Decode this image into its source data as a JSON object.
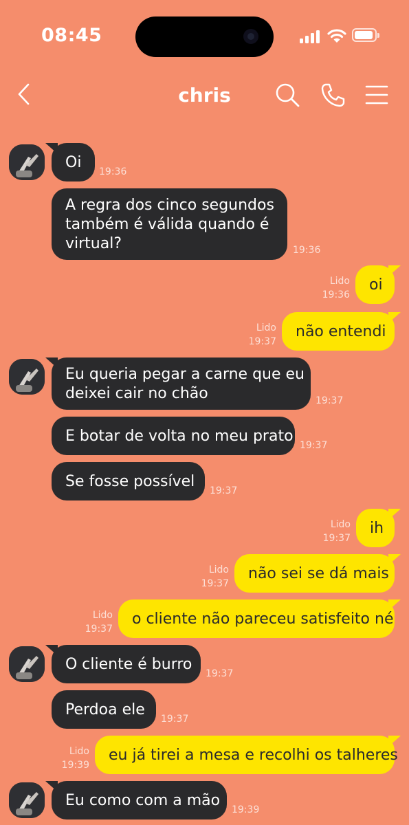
{
  "status_bar": {
    "time": "08:45"
  },
  "header": {
    "contact_name": "chris"
  },
  "messages": [
    {
      "direction": "in",
      "text": "Oi",
      "time": "19:36",
      "avatar": true
    },
    {
      "direction": "in",
      "text": "A regra dos cinco segundos também é válida quando é virtual?",
      "lines": [
        "A regra dos cinco segundos",
        "também é válida quando é",
        "virtual?"
      ],
      "time": "19:36"
    },
    {
      "direction": "out",
      "text": "oi",
      "time": "19:36",
      "read": "Lido"
    },
    {
      "direction": "out",
      "text": "não entendi",
      "time": "19:37",
      "read": "Lido"
    },
    {
      "direction": "in",
      "text": "Eu queria pegar a carne que eu deixei cair no chão",
      "lines": [
        "Eu queria pegar a carne que eu",
        "deixei cair no chão"
      ],
      "time": "19:37",
      "avatar": true
    },
    {
      "direction": "in",
      "text": "E botar de volta no meu prato",
      "time": "19:37"
    },
    {
      "direction": "in",
      "text": "Se fosse possível",
      "time": "19:37"
    },
    {
      "direction": "out",
      "text": "ih",
      "time": "19:37",
      "read": "Lido"
    },
    {
      "direction": "out",
      "text": "não sei se dá mais",
      "time": "19:37",
      "read": "Lido"
    },
    {
      "direction": "out",
      "text": "o cliente não pareceu satisfeito né",
      "time": "19:37",
      "read": "Lido"
    },
    {
      "direction": "in",
      "text": "O cliente é burro",
      "time": "19:37",
      "avatar": true
    },
    {
      "direction": "in",
      "text": "Perdoa ele",
      "time": "19:37"
    },
    {
      "direction": "out",
      "text": "eu já tirei a mesa e recolhi os talheres",
      "time": "19:39",
      "read": "Lido"
    },
    {
      "direction": "in",
      "text": "Eu como com a mão",
      "time": "19:39",
      "avatar": true
    }
  ],
  "colors": {
    "background": "#f58d6c",
    "incoming_bubble": "#2a2a2c",
    "outgoing_bubble": "#fee500"
  }
}
